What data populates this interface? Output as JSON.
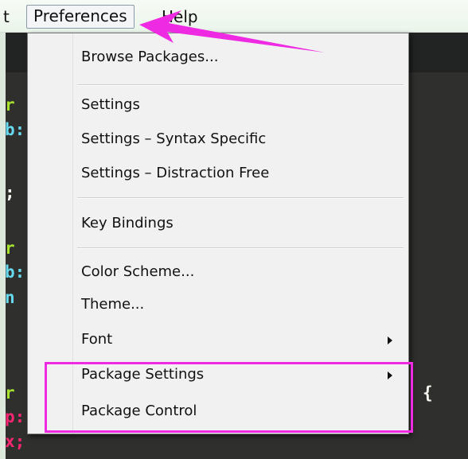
{
  "menubar": {
    "items": [
      {
        "label": "t"
      },
      {
        "label": "Preferences"
      },
      {
        "label": "Help"
      }
    ]
  },
  "editor": {
    "code_fragments": [
      {
        "text": "r",
        "color": "#a6e22e"
      },
      {
        "text": "b:",
        "color": "#66d9ef"
      },
      {
        "text": ";",
        "color": "#f8f8f2"
      },
      {
        "text": "r",
        "color": "#a6e22e"
      },
      {
        "text": "b:",
        "color": "#66d9ef"
      },
      {
        "text": "n",
        "color": "#66d9ef"
      },
      {
        "text": "r",
        "color": "#a6e22e"
      },
      {
        "text": "p:",
        "color": "#f92672"
      },
      {
        "text": "x;",
        "color": "#f92672"
      },
      {
        "text": "{",
        "color": "#f8f8f2"
      }
    ]
  },
  "preferences_menu": {
    "items": [
      {
        "label": "Browse Packages..."
      },
      {
        "label": "Settings"
      },
      {
        "label": "Settings – Syntax Specific"
      },
      {
        "label": "Settings – Distraction Free"
      },
      {
        "label": "Key Bindings"
      },
      {
        "label": "Color Scheme..."
      },
      {
        "label": "Theme..."
      },
      {
        "label": "Font",
        "has_submenu": true
      },
      {
        "label": "Package Settings",
        "has_submenu": true
      },
      {
        "label": "Package Control"
      }
    ]
  },
  "annotations": {
    "arrow_color": "#ee2be3",
    "highlight_color": "#ee2be3"
  }
}
